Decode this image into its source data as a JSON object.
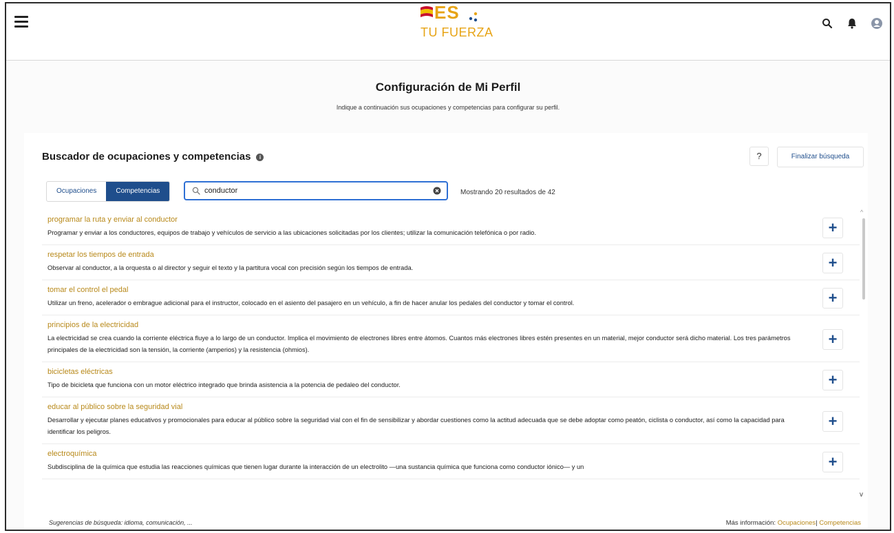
{
  "header": {
    "logo_text": "ES",
    "logo_subtitle": "TU FUERZA",
    "icons": [
      "menu-icon",
      "search-icon",
      "bell-icon",
      "user-icon"
    ]
  },
  "page": {
    "title": "Configuración de Mi Perfil",
    "subtitle": "Indique a continuación sus ocupaciones y competencias para configurar su perfil."
  },
  "search_panel": {
    "title": "Buscador de ocupaciones y competencias",
    "help_label": "?",
    "finish_label": "Finalizar búsqueda",
    "tabs": [
      {
        "label": "Ocupaciones",
        "active": false
      },
      {
        "label": "Competencias",
        "active": true
      }
    ],
    "search_value": "conductor",
    "results_text": "Mostrando 20 resultados de 42"
  },
  "results": [
    {
      "title": "programar la ruta y enviar al conductor",
      "description": "Programar y enviar a los conductores, equipos de trabajo y vehículos de servicio a las ubicaciones solicitadas por los clientes; utilizar la comunicación telefónica o por radio."
    },
    {
      "title": "respetar los tiempos de entrada",
      "description": "Observar al conductor, a la orquesta o al director y seguir el texto y la partitura vocal con precisión según los tiempos de entrada."
    },
    {
      "title": "tomar el control el pedal",
      "description": "Utilizar un freno, acelerador o embrague adicional para el instructor, colocado en el asiento del pasajero en un vehículo, a fin de hacer anular los pedales del conductor y tomar el control."
    },
    {
      "title": "principios de la electricidad",
      "description": "La electricidad se crea cuando la corriente eléctrica fluye a lo largo de un conductor. Implica el movimiento de electrones libres entre átomos. Cuantos más electrones libres estén presentes en un material, mejor conductor será dicho material. Los tres parámetros principales de la electricidad son la tensión, la corriente (amperios) y la resistencia (ohmios)."
    },
    {
      "title": "bicicletas eléctricas",
      "description": "Tipo de bicicleta que funciona con un motor eléctrico integrado que brinda asistencia a la potencia de pedaleo del conductor."
    },
    {
      "title": "educar al público sobre la seguridad vial",
      "description": "Desarrollar y ejecutar planes educativos y promocionales para educar al público sobre la seguridad vial con el fin de sensibilizar y abordar cuestiones como la actitud adecuada que se debe adoptar como peatón, ciclista o conductor, así como la capacidad para identificar los peligros."
    },
    {
      "title": "electroquímica",
      "description": "Subdisciplina de la química que estudia las reacciones químicas que tienen lugar durante la interacción de un electrolito —una sustancia química que funciona como conductor iónico— y un"
    }
  ],
  "add_label": "+",
  "footer": {
    "suggestions": "Sugerencias de búsqueda: idioma, comunicación, ...",
    "more_info_label": "Más información:",
    "link_occupations": "Ocupaciones",
    "separator": "|",
    "link_competencies": "Competencias"
  },
  "colors": {
    "primary": "#1f4e8c",
    "accent": "#b8891a",
    "logo": "#e7a416"
  }
}
